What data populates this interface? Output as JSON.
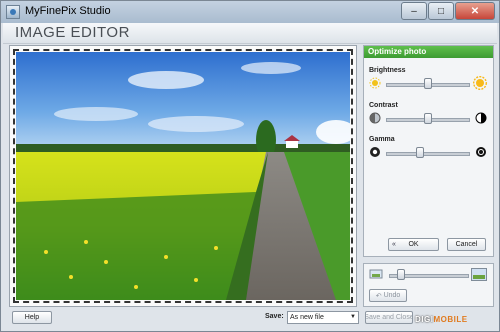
{
  "window": {
    "title": "MyFinePix Studio",
    "buttons": {
      "minimize": "–",
      "maximize": "□",
      "close": "✕"
    }
  },
  "header": {
    "title": "IMAGE EDITOR"
  },
  "photo": {
    "description_icon": "landscape-photo"
  },
  "optimize": {
    "title": "Optimize photo",
    "brightness": {
      "label": "Brightness",
      "level": 0.5
    },
    "contrast": {
      "label": "Contrast",
      "level": 0.5
    },
    "gamma": {
      "label": "Gamma",
      "level": 0.4
    },
    "ok_label": "OK",
    "cancel_label": "Cancel"
  },
  "zoom": {
    "level": 0.15
  },
  "undo_label": "Undo",
  "footer": {
    "help_label": "Help",
    "save_label": "Save:",
    "save_option": "As new file",
    "save_close_label": "Save and Close",
    "cancel_label": "Cancel",
    "watermark_a": "DIGI",
    "watermark_b": "MOBILE"
  },
  "colors": {
    "accent": "#3d9b32",
    "panel_bg": "#f3f5f7"
  }
}
